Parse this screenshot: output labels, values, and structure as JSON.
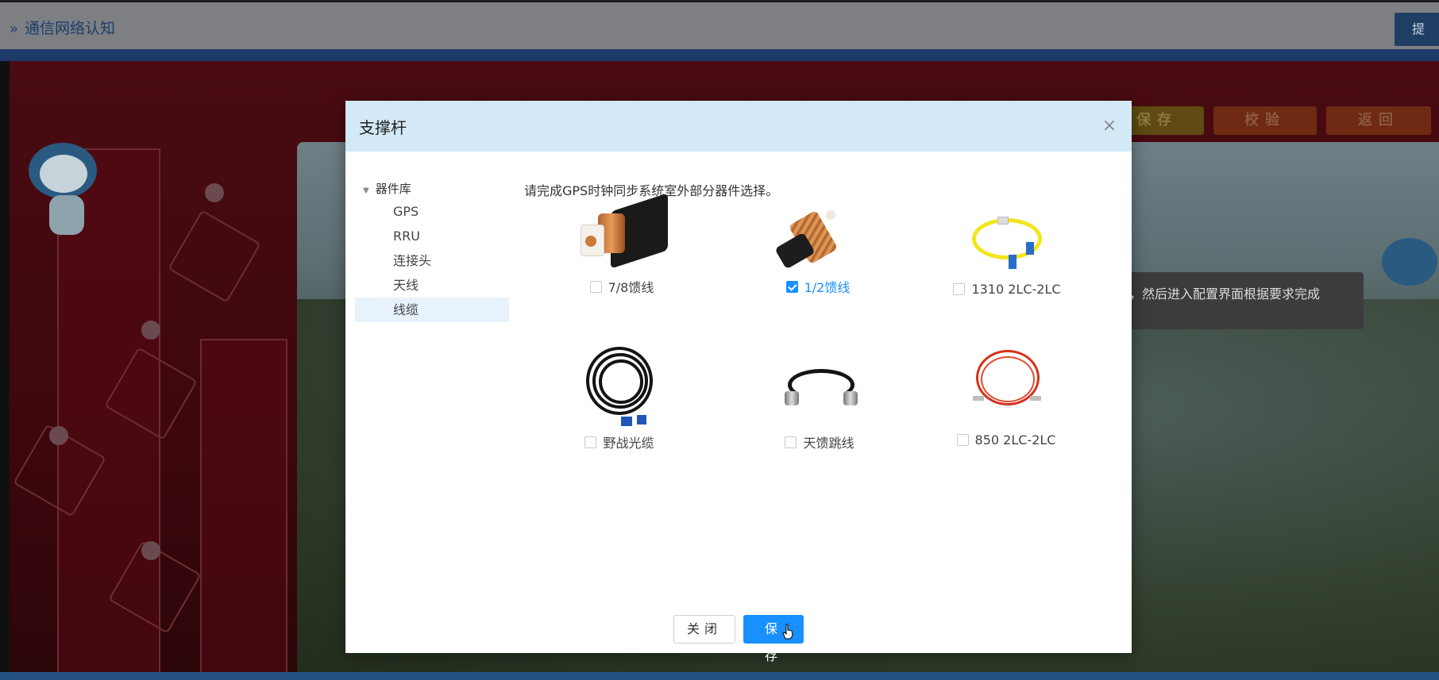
{
  "header": {
    "title": "通信网络认知",
    "submit_label": "提"
  },
  "scene": {
    "buttons": {
      "save": "保存",
      "check": "校验",
      "back": "返回"
    },
    "tip_text": "称，然后进入配置界面根据要求完成"
  },
  "modal": {
    "title": "支撑杆",
    "close_symbol": "×",
    "tree": {
      "root": "器件库",
      "items": [
        "GPS",
        "RRU",
        "连接头",
        "天线",
        "线缆"
      ],
      "active_item": "线缆"
    },
    "instruction": "请完成GPS时钟同步系统室外部分器件选择。",
    "components": [
      {
        "label": "7/8馈线",
        "checked": false
      },
      {
        "label": "1/2馈线",
        "checked": true
      },
      {
        "label": "1310 2LC-2LC",
        "checked": false
      },
      {
        "label": "野战光缆",
        "checked": false
      },
      {
        "label": "天馈跳线",
        "checked": false
      },
      {
        "label": "850 2LC-2LC",
        "checked": false
      }
    ],
    "footer": {
      "close_label": "关闭",
      "save_label": "保存"
    }
  },
  "colors": {
    "primary": "#1890ff",
    "modal_header": "#d3e9f7",
    "tree_active": "#e8f2fc"
  }
}
